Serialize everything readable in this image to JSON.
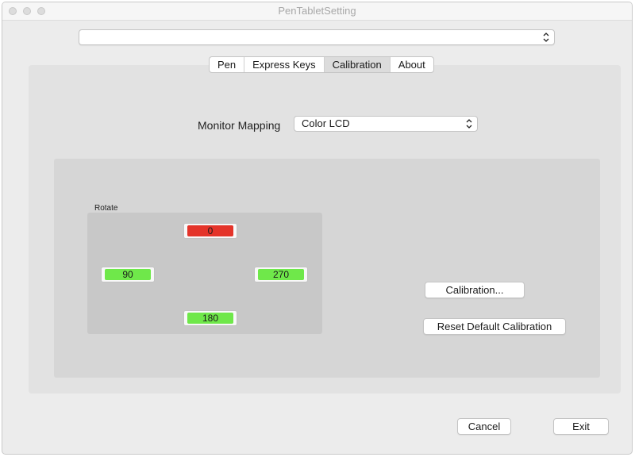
{
  "window": {
    "title": "PenTabletSetting"
  },
  "device_select": {
    "value": ""
  },
  "tabs": [
    {
      "label": "Pen",
      "active": false
    },
    {
      "label": "Express Keys",
      "active": false
    },
    {
      "label": "Calibration",
      "active": true
    },
    {
      "label": "About",
      "active": false
    }
  ],
  "monitor_mapping": {
    "label": "Monitor Mapping",
    "value": "Color LCD"
  },
  "rotate": {
    "label": "Rotate",
    "options": [
      {
        "label": "0",
        "selected": true
      },
      {
        "label": "90",
        "selected": false
      },
      {
        "label": "270",
        "selected": false
      },
      {
        "label": "180",
        "selected": false
      }
    ]
  },
  "buttons": {
    "calibration": "Calibration...",
    "reset": "Reset Default Calibration",
    "cancel": "Cancel",
    "exit": "Exit"
  },
  "colors": {
    "selected": "#e4342a",
    "unselected": "#6fe84a"
  },
  "icons": {
    "window_controls": "traffic-light-icons",
    "select_arrows": "updown-chevron-icon"
  }
}
